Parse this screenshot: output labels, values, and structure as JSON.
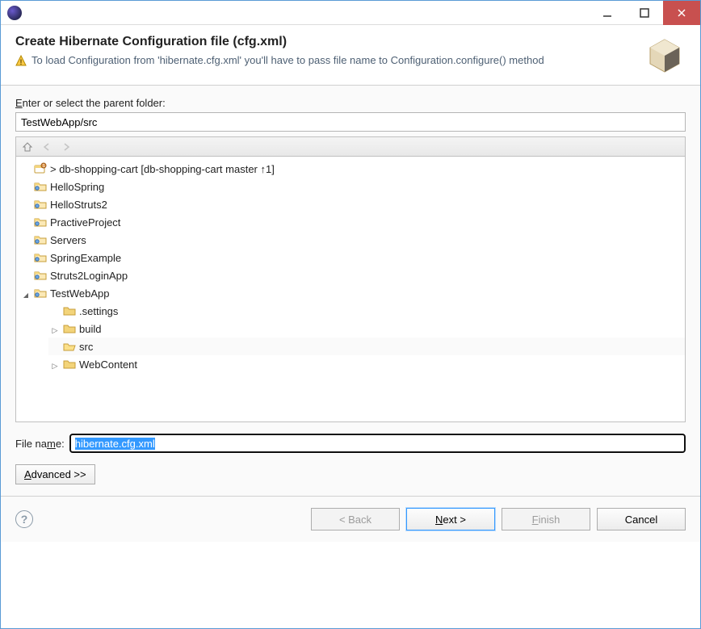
{
  "window": {
    "title": ""
  },
  "banner": {
    "heading": "Create Hibernate Configuration file (cfg.xml)",
    "message": "To load Configuration from 'hibernate.cfg.xml' you'll have to pass file name to Configuration.configure() method"
  },
  "form": {
    "parent_label_prefix": "E",
    "parent_label_rest": "nter or select the parent folder:",
    "parent_value": "TestWebApp/src",
    "filename_label_prefix": "File na",
    "filename_label_underline": "m",
    "filename_label_suffix": "e:",
    "filename_value": "hibernate.cfg.xml",
    "advanced_prefix": "A",
    "advanced_rest": "dvanced >>"
  },
  "tree": {
    "projects": [
      {
        "name": "> db-shopping-cart  [db-shopping-cart master ↑1]",
        "icon": "git-project",
        "expanded": false
      },
      {
        "name": "HelloSpring",
        "icon": "project",
        "expanded": false
      },
      {
        "name": "HelloStruts2",
        "icon": "project",
        "expanded": false
      },
      {
        "name": "PractiveProject",
        "icon": "project",
        "expanded": false
      },
      {
        "name": "Servers",
        "icon": "project",
        "expanded": false
      },
      {
        "name": "SpringExample",
        "icon": "project",
        "expanded": false
      },
      {
        "name": "Struts2LoginApp",
        "icon": "project",
        "expanded": false
      },
      {
        "name": "TestWebApp",
        "icon": "project",
        "expanded": true,
        "children": [
          {
            "name": ".settings",
            "icon": "folder",
            "has_children": false
          },
          {
            "name": "build",
            "icon": "folder",
            "has_children": true
          },
          {
            "name": "src",
            "icon": "folder",
            "has_children": false,
            "selected": true
          },
          {
            "name": "WebContent",
            "icon": "folder",
            "has_children": true
          }
        ]
      }
    ]
  },
  "footer": {
    "back": "< Back",
    "next_prefix": "N",
    "next_rest": "ext >",
    "finish_prefix": "F",
    "finish_rest": "inish",
    "cancel": "Cancel"
  }
}
